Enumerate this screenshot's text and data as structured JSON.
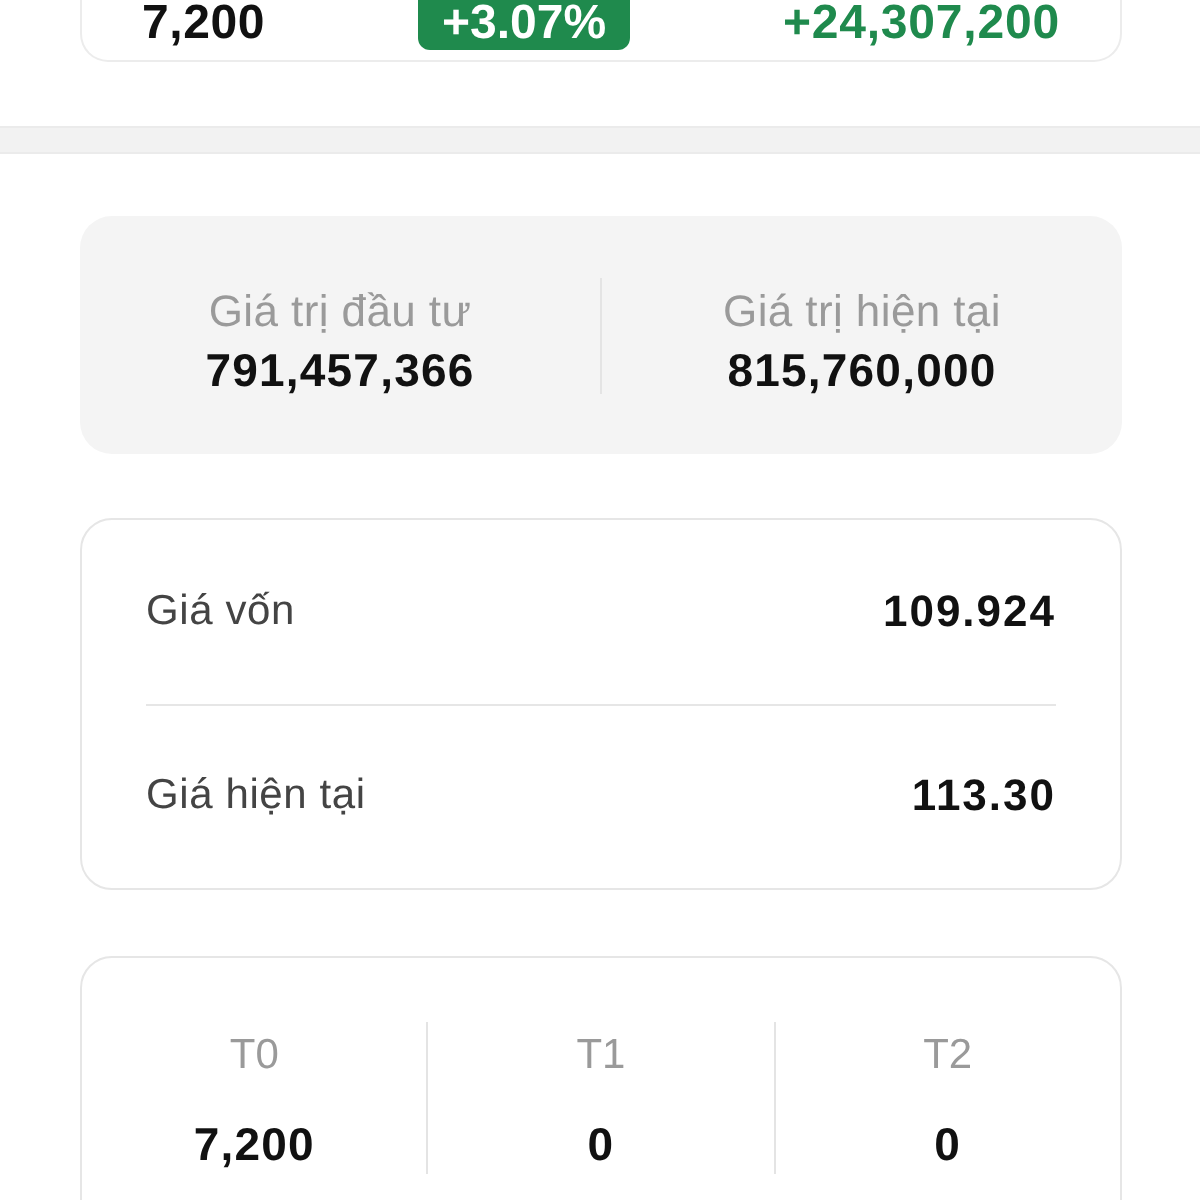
{
  "top_row": {
    "quantity": "7,200",
    "change_percent": "+3.07%",
    "profit": "+24,307,200",
    "positive": true
  },
  "summary": [
    {
      "label": "Giá trị đầu tư",
      "value": "791,457,366"
    },
    {
      "label": "Giá trị hiện tại",
      "value": "815,760,000"
    }
  ],
  "prices": [
    {
      "label": "Giá vốn",
      "value": "109.924"
    },
    {
      "label": "Giá hiện tại",
      "value": "113.30"
    }
  ],
  "settlement": [
    {
      "label": "T0",
      "value": "7,200"
    },
    {
      "label": "T1",
      "value": "0"
    },
    {
      "label": "T2",
      "value": "0"
    }
  ]
}
